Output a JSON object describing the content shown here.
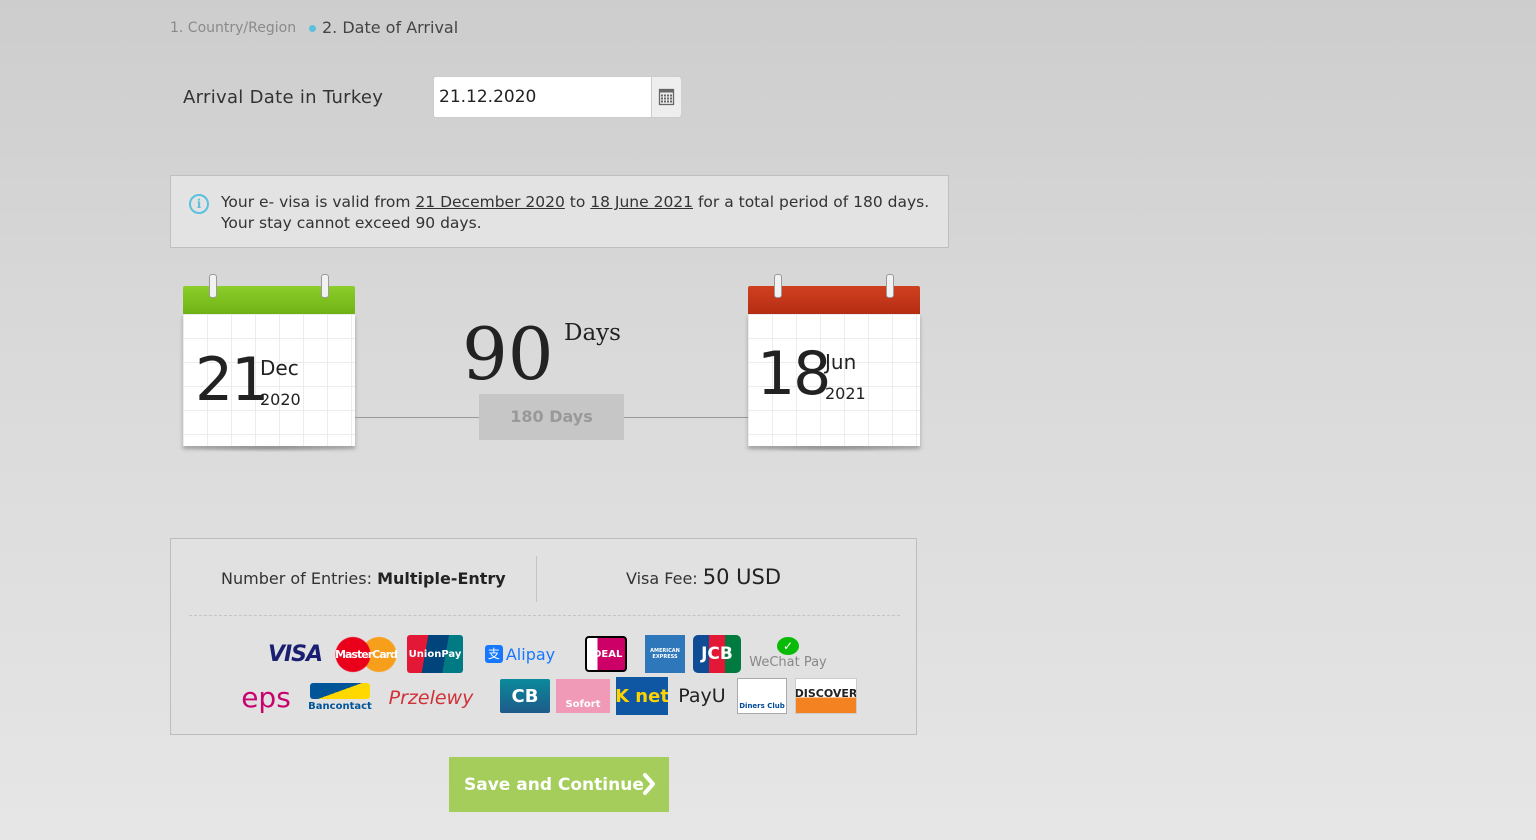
{
  "breadcrumb": {
    "step1": "1. Country/Region",
    "step2": "2. Date of Arrival"
  },
  "arrival": {
    "label": "Arrival Date in Turkey",
    "value": "21.12.2020",
    "calendar_icon": "calendar-icon"
  },
  "info": {
    "icon": "info-icon",
    "text_before": "Your e- visa is valid from ",
    "from_date": "21 December 2020",
    "to_word": " to ",
    "to_date": "18 June 2021",
    "text_after": " for a total period of 180 days. Your stay cannot exceed 90 days."
  },
  "start": {
    "day": "21",
    "month": "Dec",
    "year": "2020",
    "color": "#7fc31c"
  },
  "end": {
    "day": "18",
    "month": "Jun",
    "year": "2021",
    "color": "#c0341b"
  },
  "stay": {
    "days": "90",
    "days_label": "Days",
    "total": "180 Days"
  },
  "entries": {
    "label": "Number of Entries: ",
    "value": "Multiple-Entry"
  },
  "fee": {
    "label": "Visa Fee: ",
    "value": "50 USD"
  },
  "payment_methods": {
    "visa": "VISA",
    "mastercard": "MasterCard",
    "unionpay": "UnionPay",
    "alipay": "Alipay",
    "ideal": "iDEAL",
    "amex": "AMERICAN EXPRESS",
    "jcb": "JCB",
    "wechat": "WeChat Pay",
    "eps": "eps",
    "bancontact": "Bancontact",
    "przelewy": "Przelewy",
    "cb": "CB",
    "sofort": "Sofort",
    "knet": "K net",
    "payu": "PayU",
    "diners": "Diners Club",
    "discover": "DISCOVER"
  },
  "actions": {
    "save_label": "Save and Continue"
  }
}
